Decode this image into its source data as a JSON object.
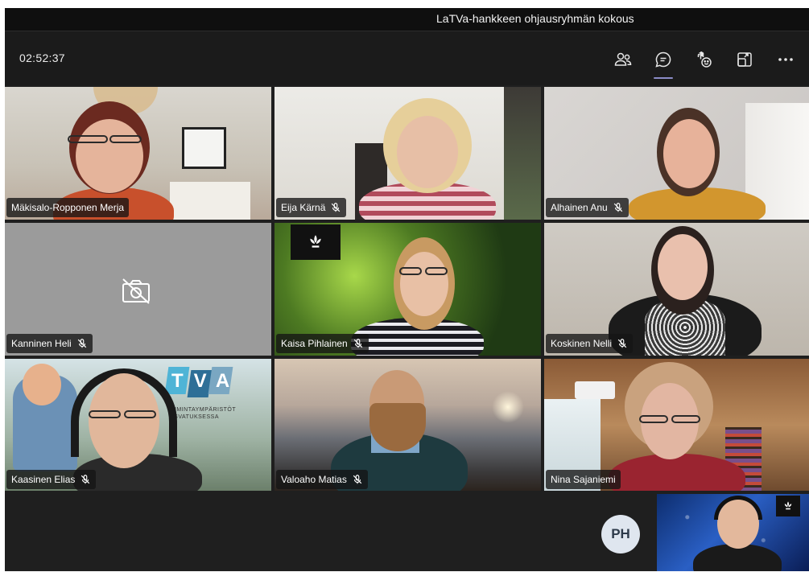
{
  "meeting": {
    "title": "LaTVa-hankkeen ohjausryhmän kokous",
    "elapsed_time": "02:52:37"
  },
  "toolbar": {
    "buttons": [
      {
        "icon": "participants-icon",
        "active": false
      },
      {
        "icon": "chat-icon",
        "active": true
      },
      {
        "icon": "reactions-icon",
        "active": false
      },
      {
        "icon": "share-tray-icon",
        "active": false
      },
      {
        "icon": "more-options-icon",
        "active": false
      }
    ]
  },
  "participants": [
    {
      "name": "Mäkisalo-Ropponen Merja",
      "muted": false,
      "video": true
    },
    {
      "name": "Eija Kärnä",
      "muted": true,
      "video": true
    },
    {
      "name": "Alhainen Anu",
      "muted": true,
      "video": true
    },
    {
      "name": "Kanninen Heli",
      "muted": true,
      "video": false
    },
    {
      "name": "Kaisa Pihlainen",
      "muted": true,
      "video": true
    },
    {
      "name": "Koskinen Nelli",
      "muted": true,
      "video": true
    },
    {
      "name": "Kaasinen Elias",
      "muted": true,
      "video": true
    },
    {
      "name": "Valoaho Matias",
      "muted": true,
      "video": true
    },
    {
      "name": "Nina Sajaniemi",
      "muted": false,
      "video": true
    }
  ],
  "overflow_avatar": {
    "initials": "PH"
  },
  "backgrounds": {
    "tva_logo_text": "TVA",
    "tva_subtitle_1": "OIMINTAYMPÄRISTÖT",
    "tva_subtitle_2": "ASVATUKSESSA"
  },
  "colors": {
    "titlebar": "#0f0f0f",
    "toolbar": "#1b1b1b",
    "stage": "#1f1f1f",
    "accent": "#8b8cc7",
    "avatar_bg": "#dfe6ef"
  }
}
